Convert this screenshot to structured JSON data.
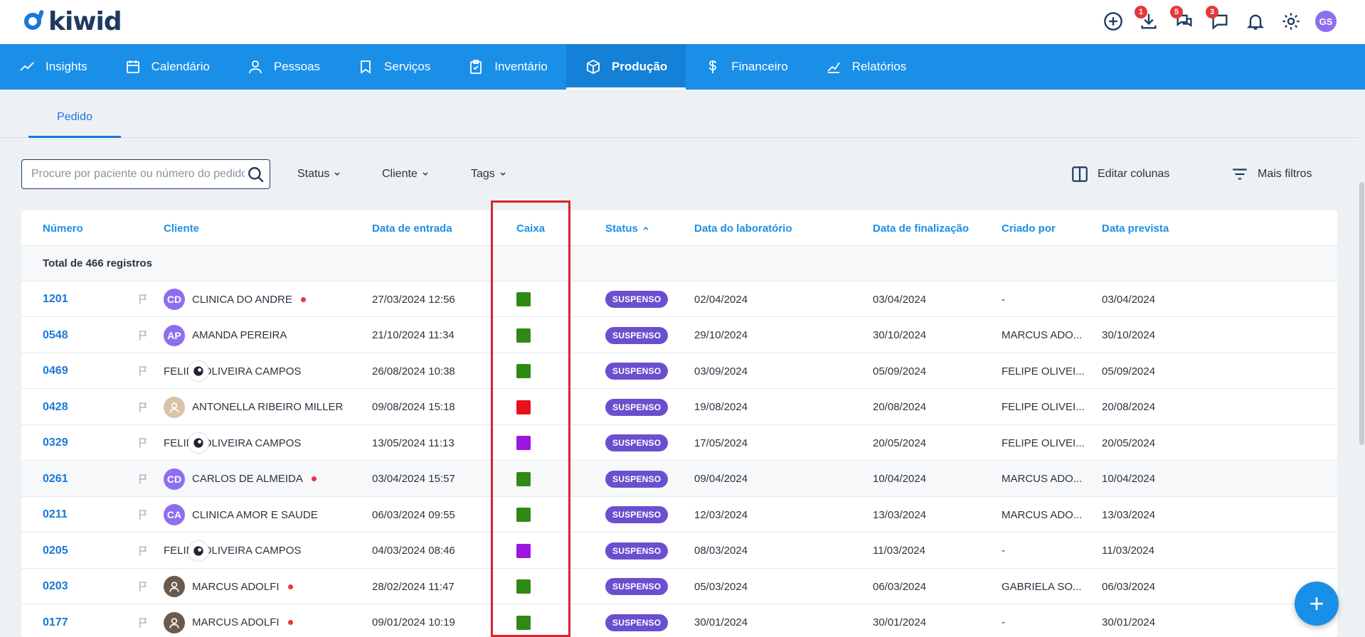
{
  "app": {
    "logo_text": "kiwid"
  },
  "topbar": {
    "icons": [
      {
        "name": "add-circle-icon",
        "badge": ""
      },
      {
        "name": "download-icon",
        "badge": "1"
      },
      {
        "name": "chat-bubbles-icon",
        "badge": "5"
      },
      {
        "name": "chat-icon",
        "badge": "3"
      },
      {
        "name": "bell-icon",
        "badge": ""
      },
      {
        "name": "gear-icon",
        "badge": ""
      }
    ],
    "user_initials": "GS"
  },
  "nav": {
    "items": [
      {
        "label": "Insights",
        "icon": "trend-icon"
      },
      {
        "label": "Calendário",
        "icon": "calendar-icon"
      },
      {
        "label": "Pessoas",
        "icon": "person-icon"
      },
      {
        "label": "Serviços",
        "icon": "tooth-icon"
      },
      {
        "label": "Inventário",
        "icon": "clipboard-icon"
      },
      {
        "label": "Produção",
        "icon": "box-icon"
      },
      {
        "label": "Financeiro",
        "icon": "dollar-icon"
      },
      {
        "label": "Relatórios",
        "icon": "chart-icon"
      }
    ],
    "active": "Produção"
  },
  "subtabs": {
    "pedido": "Pedido"
  },
  "filters": {
    "search_placeholder": "Procure por paciente ou número do pedido",
    "status": "Status",
    "cliente": "Cliente",
    "tags": "Tags",
    "editar_colunas": "Editar colunas",
    "mais_filtros": "Mais filtros"
  },
  "table": {
    "headers": {
      "numero": "Número",
      "cliente": "Cliente",
      "entrada": "Data de entrada",
      "caixa": "Caixa",
      "status": "Status",
      "lab": "Data do laboratório",
      "finalizacao": "Data de finalização",
      "criado": "Criado por",
      "prevista": "Data prevista"
    },
    "total": "Total de 466 registros",
    "rows": [
      {
        "num": "1201",
        "avatar": "CD",
        "client": "CLINICA DO ANDRE",
        "entrada": "27/03/2024 12:56",
        "caixa": "#2f8a15",
        "status": "SUSPENSO",
        "lab": "02/04/2024",
        "fin": "03/04/2024",
        "criado": "-",
        "prev": "03/04/2024"
      },
      {
        "num": "0548",
        "avatar": "AP",
        "client": "AMANDA PEREIRA",
        "entrada": "21/10/2024 11:34",
        "caixa": "#2f8a15",
        "status": "SUSPENSO",
        "lab": "29/10/2024",
        "fin": "30/10/2024",
        "criado": "MARCUS ADO...",
        "prev": "30/10/2024"
      },
      {
        "num": "0469",
        "avatar": "",
        "client": "FELIPE OLIVEIRA CAMPOS",
        "entrada": "26/08/2024 10:38",
        "caixa": "#2f8a15",
        "status": "SUSPENSO",
        "lab": "03/09/2024",
        "fin": "05/09/2024",
        "criado": "FELIPE OLIVEI...",
        "prev": "05/09/2024"
      },
      {
        "num": "0428",
        "avatar": "",
        "client": "ANTONELLA RIBEIRO MILLER",
        "entrada": "09/08/2024 15:18",
        "caixa": "#e8101a",
        "status": "SUSPENSO",
        "lab": "19/08/2024",
        "fin": "20/08/2024",
        "criado": "FELIPE OLIVEI...",
        "prev": "20/08/2024"
      },
      {
        "num": "0329",
        "avatar": "",
        "client": "FELIPE OLIVEIRA CAMPOS",
        "entrada": "13/05/2024 11:13",
        "caixa": "#9b16e0",
        "status": "SUSPENSO",
        "lab": "17/05/2024",
        "fin": "20/05/2024",
        "criado": "FELIPE OLIVEI...",
        "prev": "20/05/2024"
      },
      {
        "num": "0261",
        "avatar": "CD",
        "client": "CARLOS DE ALMEIDA",
        "entrada": "03/04/2024 15:57",
        "caixa": "#2f8a15",
        "status": "SUSPENSO",
        "lab": "09/04/2024",
        "fin": "10/04/2024",
        "criado": "MARCUS ADO...",
        "prev": "10/04/2024"
      },
      {
        "num": "0211",
        "avatar": "CA",
        "client": "CLINICA AMOR E SAUDE",
        "entrada": "06/03/2024 09:55",
        "caixa": "#2f8a15",
        "status": "SUSPENSO",
        "lab": "12/03/2024",
        "fin": "13/03/2024",
        "criado": "MARCUS ADO...",
        "prev": "13/03/2024"
      },
      {
        "num": "0205",
        "avatar": "",
        "client": "FELIPE OLIVEIRA CAMPOS",
        "entrada": "04/03/2024 08:46",
        "caixa": "#9b16e0",
        "status": "SUSPENSO",
        "lab": "08/03/2024",
        "fin": "11/03/2024",
        "criado": "-",
        "prev": "11/03/2024"
      },
      {
        "num": "0203",
        "avatar": "",
        "client": "MARCUS ADOLFI",
        "entrada": "28/02/2024 11:47",
        "caixa": "#2f8a15",
        "status": "SUSPENSO",
        "lab": "05/03/2024",
        "fin": "06/03/2024",
        "criado": "GABRIELA SO...",
        "prev": "06/03/2024"
      },
      {
        "num": "0177",
        "avatar": "",
        "client": "MARCUS ADOLFI",
        "entrada": "09/01/2024 10:19",
        "caixa": "#2f8a15",
        "status": "SUSPENSO",
        "lab": "30/01/2024",
        "fin": "30/01/2024",
        "criado": "-",
        "prev": "30/01/2024"
      }
    ]
  },
  "fab_label": "+"
}
